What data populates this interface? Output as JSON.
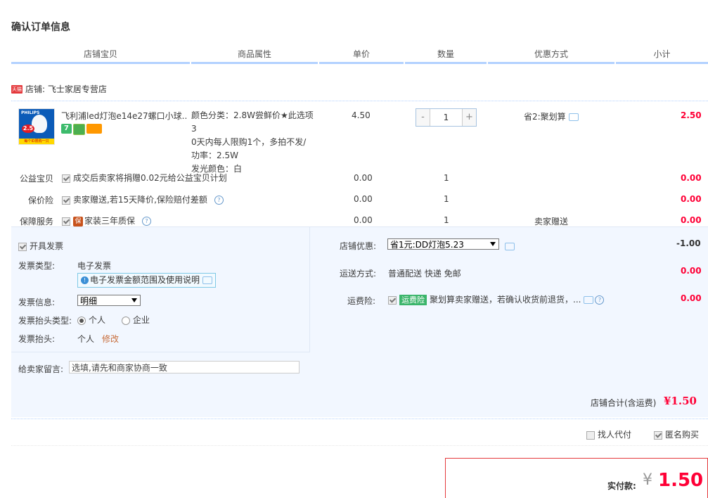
{
  "page_title": "确认订单信息",
  "columns": [
    "店铺宝贝",
    "商品属性",
    "单价",
    "数量",
    "优惠方式",
    "小计"
  ],
  "shop": {
    "badge": "天猫",
    "label": "店铺: 飞士家居专营店"
  },
  "item": {
    "title": "飞利浦led灯泡e14e27螺口小球...",
    "thumb": {
      "brand": "PHILIPS",
      "badge": "2.5",
      "strip": "每个ID限购一只"
    },
    "attrs": [
      "颜色分类：2.8W尝鲜价★此选项3",
      "0天内每人限购1个，多拍不发/",
      "功率：2.5W",
      "发光颜色：白"
    ],
    "price": "4.50",
    "quantity": "1",
    "promo": "省2:聚划算",
    "subtotal": "2.50"
  },
  "services": [
    {
      "label": "公益宝贝",
      "text": "成交后卖家将捐赠0.02元给公益宝贝计划",
      "price": "0.00",
      "qty": "1",
      "promo": "",
      "subtotal": "0.00",
      "help": false,
      "bao": ""
    },
    {
      "label": "保价险",
      "text": "卖家赠送,若15天降价,保险赔付差额",
      "price": "0.00",
      "qty": "1",
      "promo": "",
      "subtotal": "0.00",
      "help": true,
      "bao": ""
    },
    {
      "label": "保障服务",
      "text": "家装三年质保",
      "price": "0.00",
      "qty": "1",
      "promo": "卖家赠送",
      "subtotal": "0.00",
      "help": true,
      "bao": "保"
    }
  ],
  "invoice": {
    "open_label": "开具发票",
    "type_label": "发票类型:",
    "type_value": "电子发票",
    "note": "电子发票金额范围及使用说明",
    "info_label": "发票信息:",
    "info_value": "明细",
    "header_type_label": "发票抬头类型:",
    "radio_personal": "个人",
    "radio_company": "企业",
    "header_label": "发票抬头:",
    "header_value": "个人",
    "edit_link": "修改"
  },
  "shop_discount": {
    "label": "店铺优惠:",
    "value": "省1元:DD灯泡5.23",
    "amount": "-1.00"
  },
  "shipping": {
    "label": "运送方式:",
    "value": "普通配送 快递 免邮",
    "amount": "0.00"
  },
  "freight_ins": {
    "label": "运费险:",
    "badge": "运费险",
    "text": "聚划算卖家赠送，若确认收货前退货，...",
    "amount": "0.00"
  },
  "memo": {
    "label": "给卖家留言:",
    "placeholder": "选填,请先和商家协商一致"
  },
  "shop_total": {
    "label": "店铺合计(含运费)",
    "value": "¥1.50"
  },
  "options": {
    "proxy_pay": "找人代付",
    "anonymous": "匿名购买"
  },
  "payment": {
    "label": "实付款:",
    "currency": "¥",
    "value": "1.50"
  },
  "colors": {
    "accent_red": "#ff0036",
    "header_line": "#b2d1ff",
    "panel_bg": "#f2f7ff"
  }
}
